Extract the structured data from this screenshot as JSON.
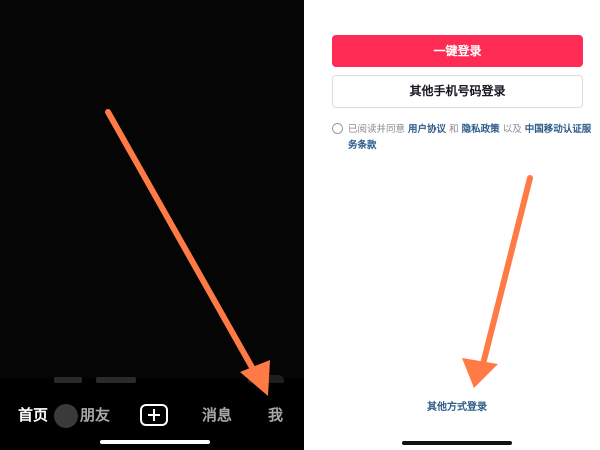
{
  "left_screen": {
    "tabs": [
      {
        "label": "首页",
        "active": true
      },
      {
        "label": "朋友",
        "active": false
      },
      {
        "label": "消息",
        "active": false
      },
      {
        "label": "我",
        "active": false
      }
    ],
    "create_icon": "plus-square-icon"
  },
  "right_screen": {
    "one_click_login_label": "一键登录",
    "other_phone_login_label": "其他手机号码登录",
    "agreement": {
      "prefix": "已阅读并同意",
      "user_agreement": "用户协议",
      "and": "和",
      "privacy_policy": "隐私政策",
      "and_also": "以及",
      "carrier_terms": "中国移动认证服务条款"
    },
    "other_methods_label": "其他方式登录"
  },
  "colors": {
    "accent": "#fe2c55",
    "link": "#2e5c8a",
    "annotation_arrow": "#ff7a45"
  }
}
